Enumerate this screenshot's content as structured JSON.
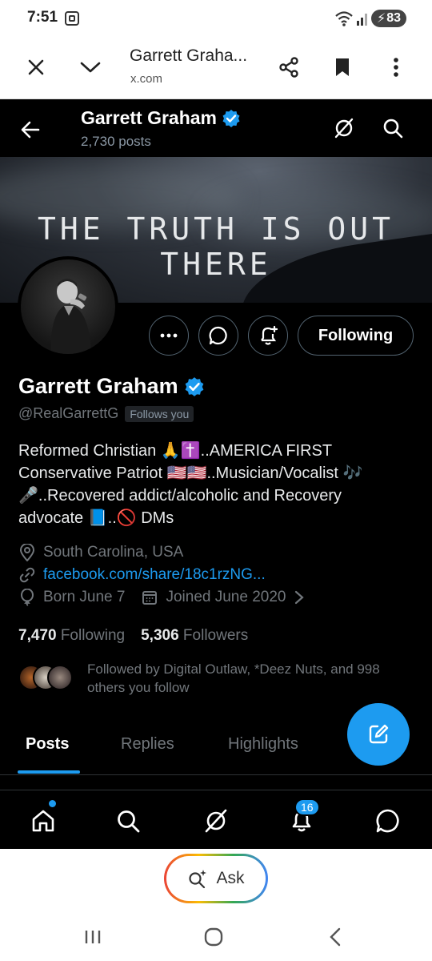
{
  "status_bar": {
    "time": "7:51",
    "battery": "83"
  },
  "browser": {
    "page_title": "Garrett Graha...",
    "domain": "x.com"
  },
  "profile_header": {
    "name": "Garrett Graham",
    "posts_count": "2,730 posts"
  },
  "banner": {
    "text": "THE TRUTH IS OUT THERE"
  },
  "actions": {
    "following_label": "Following"
  },
  "profile": {
    "name": "Garrett Graham",
    "handle": "@RealGarrettG",
    "follows_you": "Follows you",
    "bio": {
      "line1": "Reformed Christian 🙏✝️..AMERICA FIRST",
      "line2": "Conservative Patriot 🇺🇸🇺🇸..Musician/Vocalist 🎶",
      "line3": "🎤..Recovered addict/alcoholic and Recovery",
      "line4": "advocate 📘..🚫 DMs"
    },
    "location": "South Carolina, USA",
    "website": "facebook.com/share/18c1rzNG...",
    "born": "Born June 7",
    "joined": "Joined June 2020",
    "following_count": "7,470",
    "following_label": "Following",
    "followers_count": "5,306",
    "followers_label": "Followers",
    "followed_by": "Followed by Digital Outlaw, *Deez Nuts, and 998 others you follow"
  },
  "tabs": [
    "Posts",
    "Replies",
    "Highlights"
  ],
  "active_tab": "Posts",
  "bottom_nav": {
    "notifications_badge": "16"
  },
  "assistant": {
    "ask_label": "Ask"
  },
  "colors": {
    "accent": "#1d9bf0",
    "background": "#000000",
    "muted": "#71767b"
  }
}
